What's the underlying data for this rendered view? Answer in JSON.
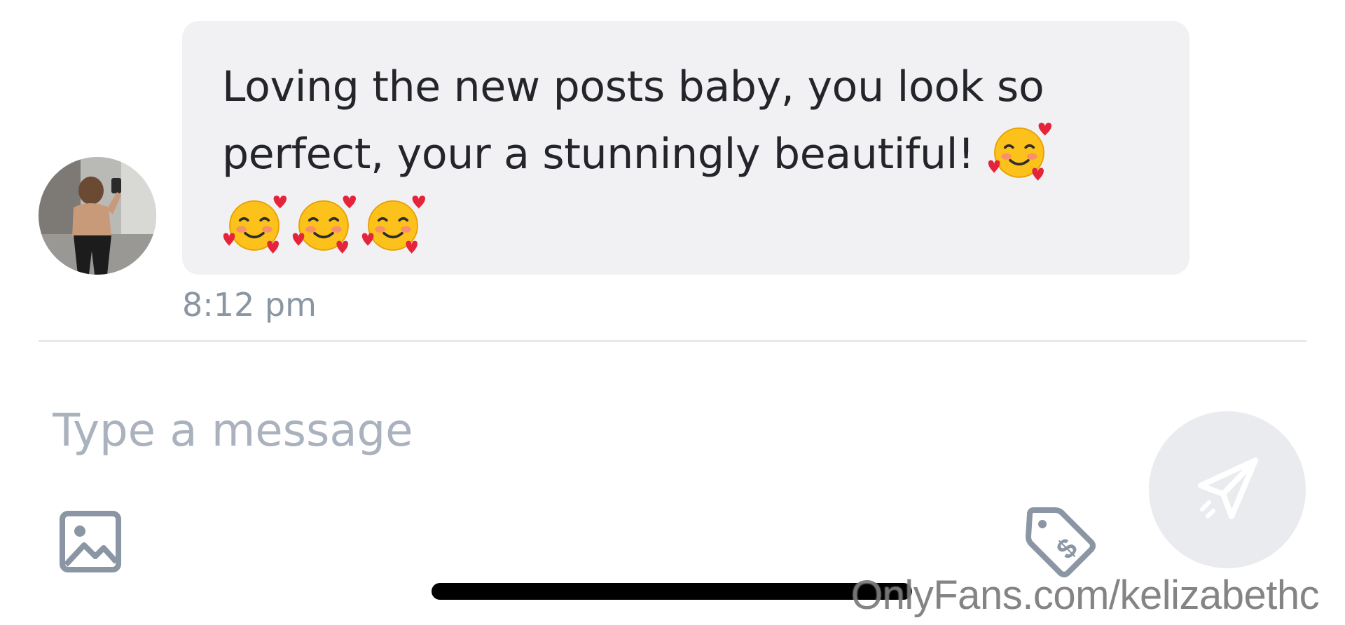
{
  "message": {
    "text": "Loving the new posts baby, you look so perfect, your a stunningly beautiful!",
    "emojis": [
      "smiling-face-with-hearts",
      "smiling-face-with-hearts",
      "smiling-face-with-hearts",
      "smiling-face-with-hearts"
    ],
    "time": "8:12 pm"
  },
  "composer": {
    "placeholder": "Type a message",
    "value": ""
  },
  "icons": {
    "media": "image-icon",
    "price": "price-tag-icon",
    "send": "send-icon"
  },
  "watermark": "OnlyFans.com/kelizabethc",
  "colors": {
    "bubble": "#f1f1f3",
    "text": "#23252a",
    "muted": "#8a96a3",
    "placeholder": "#aab2bd",
    "icon": "#8a96a3",
    "send_bg": "#e9ebee"
  }
}
